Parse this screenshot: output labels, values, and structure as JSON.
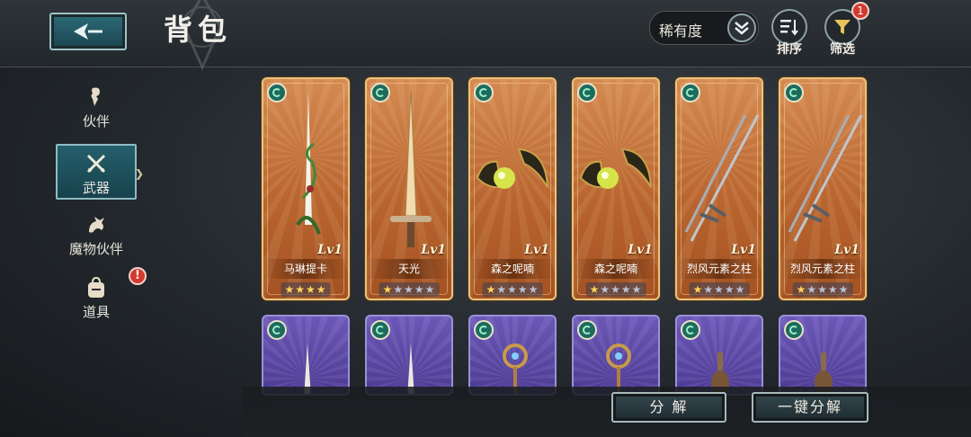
{
  "header": {
    "title": "背包",
    "rarity_filter": "稀有度",
    "sort_label": "排序",
    "filter_label": "筛选",
    "filter_badge": "1"
  },
  "sidebar": {
    "items": [
      {
        "label": "伙伴",
        "icon": "companion-icon"
      },
      {
        "label": "武器",
        "icon": "crossed-swords-icon",
        "active": true
      },
      {
        "label": "魔物伙伴",
        "icon": "dragon-icon"
      },
      {
        "label": "道具",
        "icon": "backpack-icon"
      }
    ],
    "items_badge": "!"
  },
  "weapons": [
    {
      "name": "马琳提卡",
      "level": "Lv1",
      "stars_filled": 4,
      "stars_total": 4
    },
    {
      "name": "天光",
      "level": "Lv1",
      "stars_filled": 1,
      "stars_total": 5
    },
    {
      "name": "森之呢喃",
      "level": "Lv1",
      "stars_filled": 1,
      "stars_total": 5
    },
    {
      "name": "森之呢喃",
      "level": "Lv1",
      "stars_filled": 1,
      "stars_total": 5
    },
    {
      "name": "烈风元素之柱",
      "level": "Lv1",
      "stars_filled": 1,
      "stars_total": 5
    },
    {
      "name": "烈风元素之柱",
      "level": "Lv1",
      "stars_filled": 1,
      "stars_total": 5
    }
  ],
  "actions": {
    "decompose": "分 解",
    "one_click_decompose": "一键分解"
  },
  "colors": {
    "gold_card": "#c0703a",
    "purple_card": "#5a48a6",
    "accent_teal": "#245f6c",
    "badge_red": "#d23a2e"
  }
}
